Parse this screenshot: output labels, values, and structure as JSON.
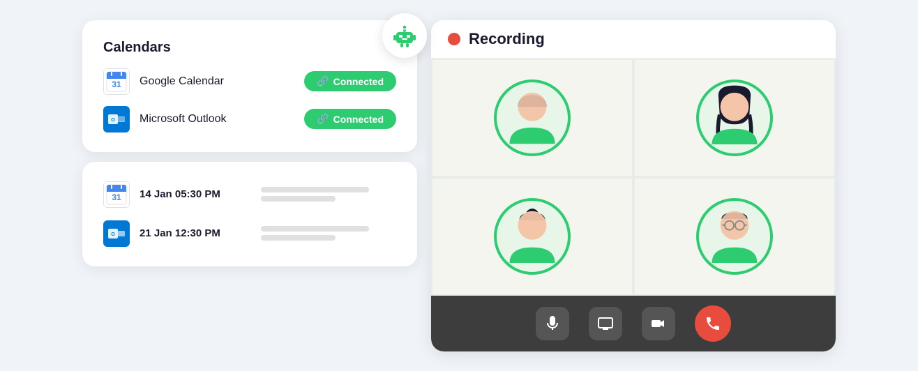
{
  "calendars": {
    "title": "Calendars",
    "items": [
      {
        "name": "Google Calendar",
        "status": "Connected",
        "type": "google"
      },
      {
        "name": "Microsoft Outlook",
        "status": "Connected",
        "type": "outlook"
      }
    ]
  },
  "events": {
    "items": [
      {
        "date": "14 Jan 05:30 PM",
        "type": "google"
      },
      {
        "date": "21 Jan 12:30 PM",
        "type": "outlook"
      }
    ]
  },
  "recording": {
    "label": "Recording"
  },
  "participants": [
    {
      "id": "p1",
      "style": "male1"
    },
    {
      "id": "p2",
      "style": "female1"
    },
    {
      "id": "p3",
      "style": "female2"
    },
    {
      "id": "p4",
      "style": "glasses"
    }
  ],
  "controls": {
    "mic_label": "Microphone",
    "screen_label": "Screen Share",
    "camera_label": "Camera",
    "end_label": "End Call"
  }
}
